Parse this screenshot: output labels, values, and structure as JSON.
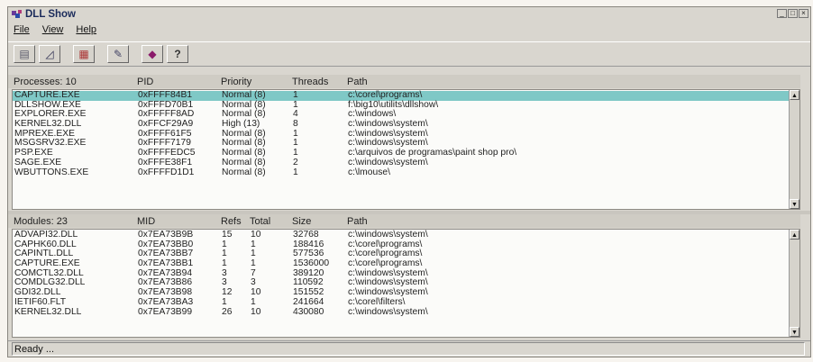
{
  "window": {
    "title": "DLL Show",
    "icon": "dllshow-app-icon"
  },
  "menu": [
    "File",
    "View",
    "Help"
  ],
  "toolbar": [
    {
      "name": "properties-icon",
      "glyph": "▤"
    },
    {
      "name": "draw-icon",
      "glyph": "◿"
    },
    {
      "name": "layout-icon",
      "glyph": "▦"
    },
    {
      "name": "edit-tool-icon",
      "glyph": "✎"
    },
    {
      "name": "book-icon",
      "glyph": "◆"
    },
    {
      "name": "help-icon",
      "glyph": "?"
    }
  ],
  "processes": {
    "header": {
      "count": "Processes: 10",
      "pid": "PID",
      "priority": "Priority",
      "threads": "Threads",
      "path": "Path"
    },
    "rows": [
      {
        "name": "CAPTURE.EXE",
        "pid": "0xFFFF84B1",
        "priority": "Normal (8)",
        "threads": "1",
        "path": "c:\\corel\\programs\\",
        "selected": true
      },
      {
        "name": "DLLSHOW.EXE",
        "pid": "0xFFFD70B1",
        "priority": "Normal (8)",
        "threads": "1",
        "path": "f:\\big10\\utilits\\dllshow\\"
      },
      {
        "name": "EXPLORER.EXE",
        "pid": "0xFFFFF8AD",
        "priority": "Normal (8)",
        "threads": "4",
        "path": "c:\\windows\\"
      },
      {
        "name": "KERNEL32.DLL",
        "pid": "0xFFCF29A9",
        "priority": "High (13)",
        "threads": "8",
        "path": "c:\\windows\\system\\"
      },
      {
        "name": "MPREXE.EXE",
        "pid": "0xFFFF61F5",
        "priority": "Normal (8)",
        "threads": "1",
        "path": "c:\\windows\\system\\"
      },
      {
        "name": "MSGSRV32.EXE",
        "pid": "0xFFFF7179",
        "priority": "Normal (8)",
        "threads": "1",
        "path": "c:\\windows\\system\\"
      },
      {
        "name": "PSP.EXE",
        "pid": "0xFFFFEDC5",
        "priority": "Normal (8)",
        "threads": "1",
        "path": "c:\\arquivos de programas\\paint shop pro\\"
      },
      {
        "name": "SAGE.EXE",
        "pid": "0xFFFE38F1",
        "priority": "Normal (8)",
        "threads": "2",
        "path": "c:\\windows\\system\\"
      },
      {
        "name": "WBUTTONS.EXE",
        "pid": "0xFFFFD1D1",
        "priority": "Normal (8)",
        "threads": "1",
        "path": "c:\\lmouse\\"
      }
    ]
  },
  "modules": {
    "header": {
      "count": "Modules: 23",
      "mid": "MID",
      "refs": "Refs",
      "total": "Total",
      "size": "Size",
      "path": "Path"
    },
    "rows": [
      {
        "name": "ADVAPI32.DLL",
        "mid": "0x7EA73B9B",
        "refs": "15",
        "total": "10",
        "size": "32768",
        "path": "c:\\windows\\system\\"
      },
      {
        "name": "CAPHK60.DLL",
        "mid": "0x7EA73BB0",
        "refs": "1",
        "total": "1",
        "size": "188416",
        "path": "c:\\corel\\programs\\"
      },
      {
        "name": "CAPINTL.DLL",
        "mid": "0x7EA73BB7",
        "refs": "1",
        "total": "1",
        "size": "577536",
        "path": "c:\\corel\\programs\\"
      },
      {
        "name": "CAPTURE.EXE",
        "mid": "0x7EA73BB1",
        "refs": "1",
        "total": "1",
        "size": "1536000",
        "path": "c:\\corel\\programs\\"
      },
      {
        "name": "COMCTL32.DLL",
        "mid": "0x7EA73B94",
        "refs": "3",
        "total": "7",
        "size": "389120",
        "path": "c:\\windows\\system\\"
      },
      {
        "name": "COMDLG32.DLL",
        "mid": "0x7EA73B86",
        "refs": "3",
        "total": "3",
        "size": "110592",
        "path": "c:\\windows\\system\\"
      },
      {
        "name": "GDI32.DLL",
        "mid": "0x7EA73B98",
        "refs": "12",
        "total": "10",
        "size": "151552",
        "path": "c:\\windows\\system\\"
      },
      {
        "name": "IETIF60.FLT",
        "mid": "0x7EA73BA3",
        "refs": "1",
        "total": "1",
        "size": "241664",
        "path": "c:\\corel\\filters\\"
      },
      {
        "name": "KERNEL32.DLL",
        "mid": "0x7EA73B99",
        "refs": "26",
        "total": "10",
        "size": "430080",
        "path": "c:\\windows\\system\\"
      }
    ]
  },
  "status": "Ready ...",
  "colors": {
    "selection": "#7fc8c6",
    "face": "#d9d6cf",
    "title": "#1a2a5a"
  }
}
